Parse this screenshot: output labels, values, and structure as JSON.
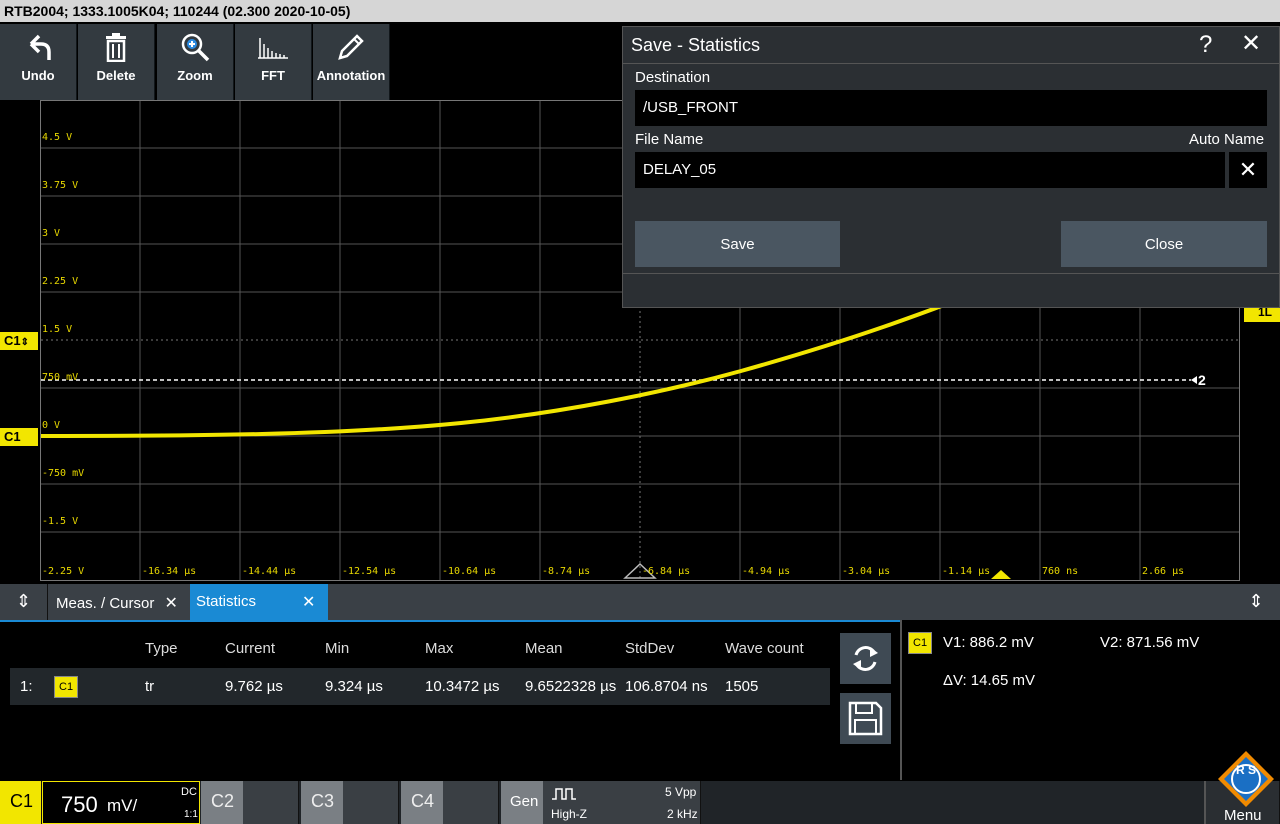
{
  "title_bar": "RTB2004; 1333.1005K04; 110244 (02.300 2020-10-05)",
  "toolbar": {
    "undo": "Undo",
    "delete": "Delete",
    "zoom": "Zoom",
    "fft": "FFT",
    "annotation": "Annotation"
  },
  "waveform": {
    "y_labels": [
      "4.5 V",
      "3.75 V",
      "3 V",
      "2.25 V",
      "1.5 V",
      "750 mV",
      "0 V",
      "-750 mV",
      "-1.5 V",
      "-2.25 V"
    ],
    "x_labels": [
      "-16.34 µs",
      "-14.44 µs",
      "-12.54 µs",
      "-10.64 µs",
      "-8.74 µs",
      "-6.84 µs",
      "-4.94 µs",
      "-3.04 µs",
      "-1.14 µs",
      "760 ns",
      "2.66 µs"
    ],
    "ch1_marker": "C1",
    "ch1_offset_marker": "C1",
    "cursor_marker": "2",
    "right_marker": "1L",
    "trace_color": "#f2e600"
  },
  "dialog": {
    "title": "Save - Statistics",
    "help": "?",
    "close_icon": "✕",
    "destination_label": "Destination",
    "destination_value": "/USB_FRONT",
    "filename_label": "File Name",
    "auto_name_label": "Auto Name",
    "filename_value": "DELAY_05",
    "save_button": "Save",
    "close_button": "Close"
  },
  "tabs": {
    "meas_cursor": "Meas. / Cursor",
    "statistics": "Statistics"
  },
  "stats": {
    "headers": [
      "Type",
      "Current",
      "Min",
      "Max",
      "Mean",
      "StdDev",
      "Wave count"
    ],
    "row": {
      "index": "1:",
      "source": "C1",
      "type": "tr",
      "current": "9.762 µs",
      "min": "9.324 µs",
      "max": "10.3472 µs",
      "mean": "9.6522328 µs",
      "stddev": "106.8704 ns",
      "wave_count": "1505"
    }
  },
  "cursor": {
    "source": "C1",
    "v1": "V1: 886.2 mV",
    "v2": "V2: 871.56 mV",
    "dv": "ΔV: 14.65 mV"
  },
  "bottom": {
    "c1": "C1",
    "c1_scale": "750",
    "c1_unit": "mV/",
    "c1_coupling": "DC",
    "c1_probe": "1:1",
    "c2": "C2",
    "c3": "C3",
    "c4": "C4",
    "gen": "Gen",
    "gen_impedance": "High-Z",
    "gen_vpp": "5 Vpp",
    "gen_freq": "2 kHz",
    "menu": "Menu",
    "logo_text": "R S"
  }
}
